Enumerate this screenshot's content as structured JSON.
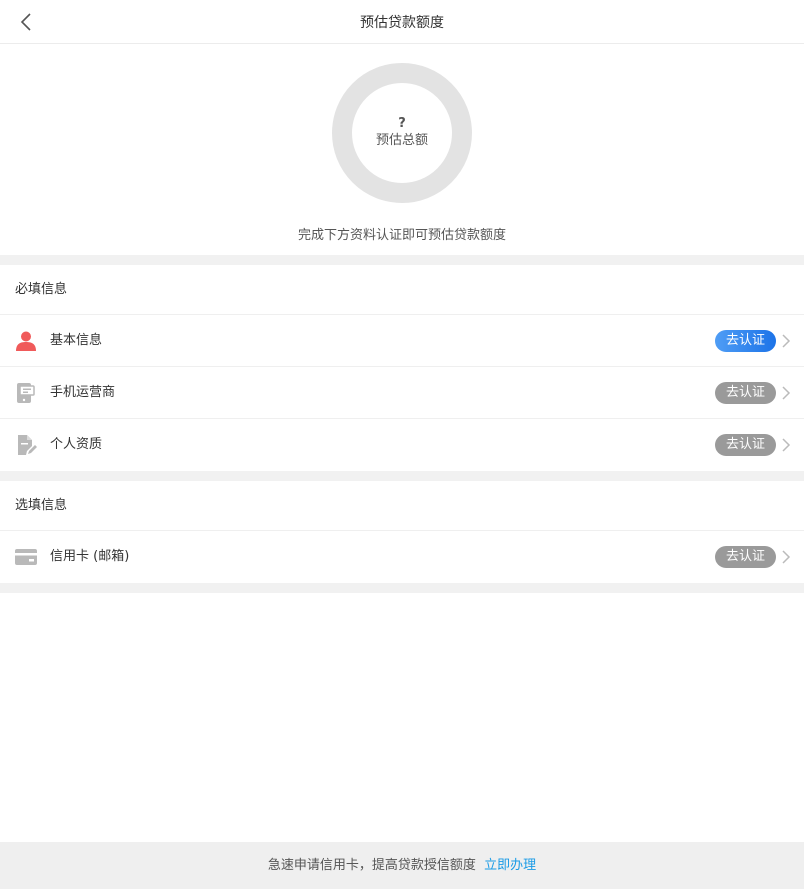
{
  "header": {
    "title": "预估贷款额度"
  },
  "estimate": {
    "value": "?",
    "label": "预估总额",
    "hint": "完成下方资料认证即可预估贷款额度"
  },
  "required": {
    "title": "必填信息",
    "items": [
      {
        "label": "基本信息",
        "action": "去认证",
        "icon": "person-icon",
        "status_color": "#2a7fe9"
      },
      {
        "label": "手机运营商",
        "action": "去认证",
        "icon": "phone-carrier-icon",
        "status_color": "#9a9a9a"
      },
      {
        "label": "个人资质",
        "action": "去认证",
        "icon": "document-edit-icon",
        "status_color": "#9a9a9a"
      }
    ]
  },
  "optional": {
    "title": "选填信息",
    "items": [
      {
        "label": "信用卡 (邮箱)",
        "action": "去认证",
        "icon": "credit-card-icon",
        "status_color": "#9a9a9a"
      }
    ]
  },
  "footer": {
    "text": "急速申请信用卡，提高贷款授信额度",
    "link": "立即办理"
  },
  "colors": {
    "accent": "#1a9be6",
    "primary_badge": "#1c73e8",
    "inactive_badge": "#9a9a9a",
    "person_icon": "#f05a5a",
    "ring": "#e3e3e3"
  }
}
